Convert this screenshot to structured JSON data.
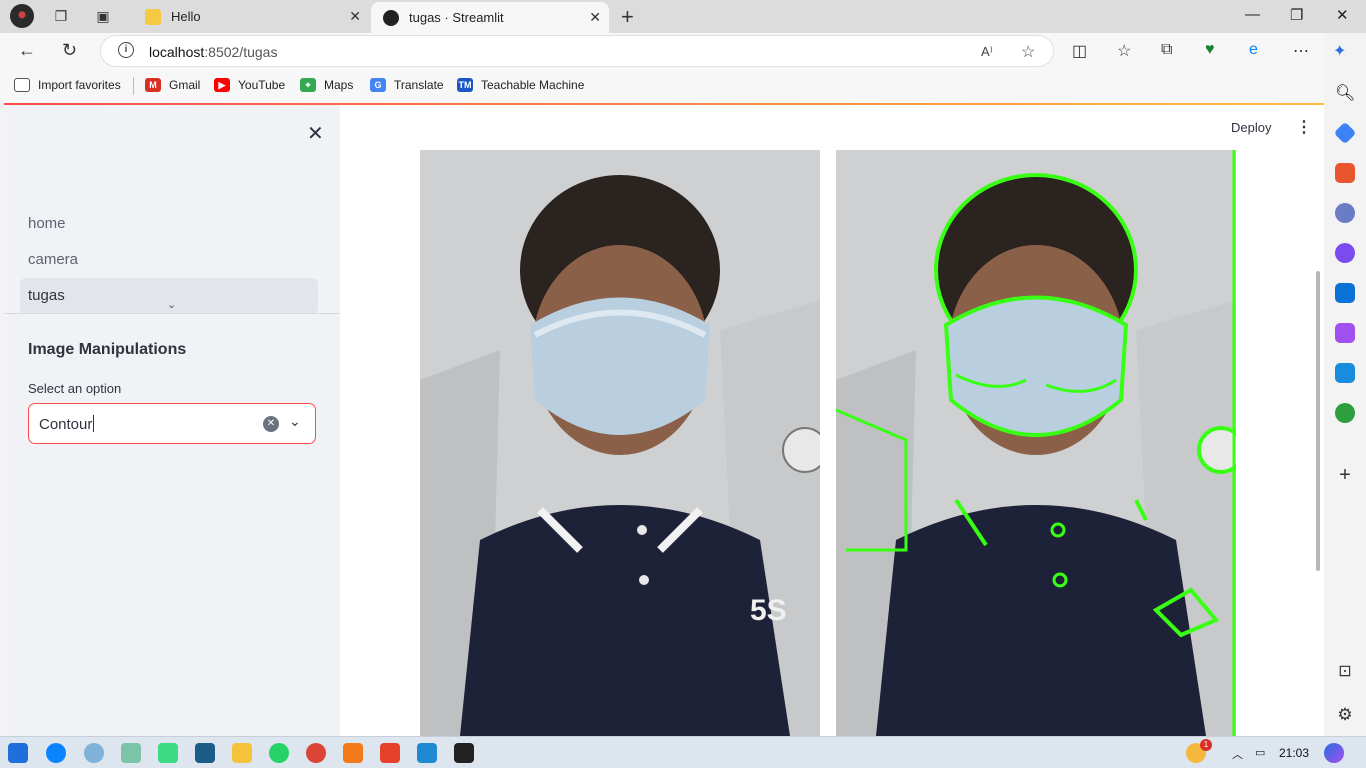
{
  "browser": {
    "tabs": [
      {
        "title": "Hello",
        "active": false
      },
      {
        "title": "tugas · Streamlit",
        "active": true
      }
    ],
    "address": {
      "host": "localhost",
      "rest": ":8502/tugas"
    },
    "favorites": [
      "Import favorites",
      "Gmail",
      "YouTube",
      "Maps",
      "Translate",
      "Teachable Machine"
    ]
  },
  "app": {
    "deploy_label": "Deploy",
    "sidebar": {
      "nav": [
        "home",
        "camera",
        "tugas"
      ],
      "active_nav": "tugas",
      "heading": "Image Manipulations",
      "select_label": "Select an option",
      "select_value": "Contour"
    },
    "images": [
      {
        "name": "original-photo",
        "contour": false
      },
      {
        "name": "contour-photo",
        "contour": true,
        "contour_color": "#39ff14"
      }
    ]
  },
  "taskbar": {
    "clock": "21:03",
    "notification_count": "1"
  },
  "colors": {
    "accent": "#ff4b4b",
    "sidebar_bg": "#f0f2f6"
  }
}
